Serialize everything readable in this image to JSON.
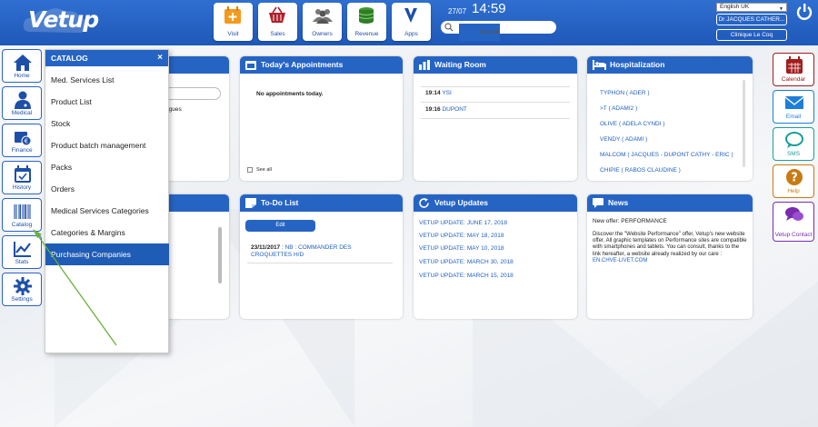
{
  "header": {
    "logo": "Vetup",
    "nav": [
      {
        "label": "Visit",
        "icon": "plus-calendar-icon"
      },
      {
        "label": "Sales",
        "icon": "basket-icon"
      },
      {
        "label": "Owners",
        "icon": "people-icon"
      },
      {
        "label": "Revenue",
        "icon": "coins-icon"
      },
      {
        "label": "Apps",
        "icon": "apps-icon"
      }
    ],
    "date": "27/07",
    "time": "14:59",
    "search_placeholder": "Search",
    "language": "English UK",
    "user": "Dr JACQUES CATHER...",
    "clinic": "Clinique Le Coq"
  },
  "left_sidebar": [
    {
      "label": "Home",
      "icon": "home-icon"
    },
    {
      "label": "Medical",
      "icon": "doctor-icon"
    },
    {
      "label": "Finance",
      "icon": "finance-icon"
    },
    {
      "label": "History",
      "icon": "history-icon"
    },
    {
      "label": "Catalog",
      "icon": "barcode-icon"
    },
    {
      "label": "Stats",
      "icon": "stats-icon"
    },
    {
      "label": "Settings",
      "icon": "gear-icon"
    }
  ],
  "right_sidebar": [
    {
      "label": "Calendar",
      "icon": "calendar-icon",
      "color": "#a21d1d"
    },
    {
      "label": "Email",
      "icon": "email-icon",
      "color": "#1f7fd6"
    },
    {
      "label": "SMS",
      "icon": "sms-icon",
      "color": "#1a9e9a"
    },
    {
      "label": "Help",
      "icon": "help-icon",
      "color": "#c87a12"
    },
    {
      "label": "Vetup Contact",
      "icon": "contact-icon",
      "color": "#7a2bb0"
    }
  ],
  "catalog_menu": {
    "title": "CATALOG",
    "close": "×",
    "items": [
      "Med. Services List",
      "Product List",
      "Stock",
      "Product batch management",
      "Packs",
      "Orders",
      "Medical Services Categories",
      "Categories & Margins",
      "Purchasing Companies"
    ],
    "active_index": 8
  },
  "hidden_panel_text": "agues",
  "appointments": {
    "title": "Today's Appointments",
    "empty_text": "No appointments today.",
    "see_all": "See all"
  },
  "waiting_room": {
    "title": "Waiting Room",
    "items": [
      {
        "time": "19:14",
        "name": "YSI"
      },
      {
        "time": "19:16",
        "name": "DUPONT"
      }
    ]
  },
  "hospitalization": {
    "title": "Hospitalization",
    "items": [
      "TYPHON ( ADER )",
      ">T ( ADAMI2 )",
      "OLIVE ( ADELA CYNDI )",
      "VENDY ( ADAMI )",
      "MALCOM ( JACQUES - DUPONT CATHY - ERIC )",
      "CHIPIE ( RABOS CLAUDINE )"
    ]
  },
  "todo": {
    "title": "To-Do List",
    "edit_label": "Edit",
    "items": [
      {
        "date": "23/11/2017",
        "text": "NB : COMMANDER DES CROQUETTES H/D"
      }
    ]
  },
  "updates": {
    "title": "Vetup Updates",
    "items": [
      "VETUP UPDATE: JUNE 17, 2018",
      "VETUP UPDATE: MAY 18, 2018",
      "VETUP UPDATE: MAY 10, 2018",
      "VETUP UPDATE: MARCH 30, 2018",
      "VETUP UPDATE: MARCH 15, 2018"
    ]
  },
  "news": {
    "title": "News",
    "headline": "New offer: PERFORMANCE",
    "body": "Discover the \"Website Performance\" offer, Vetup's new website offer. All graphic templates on Performance sites are compatible with smartphones and tablets. You can consult, thanks to the link hereafter, a website already realized by our care :",
    "link": "EN.CHVE-LIVET.COM"
  }
}
